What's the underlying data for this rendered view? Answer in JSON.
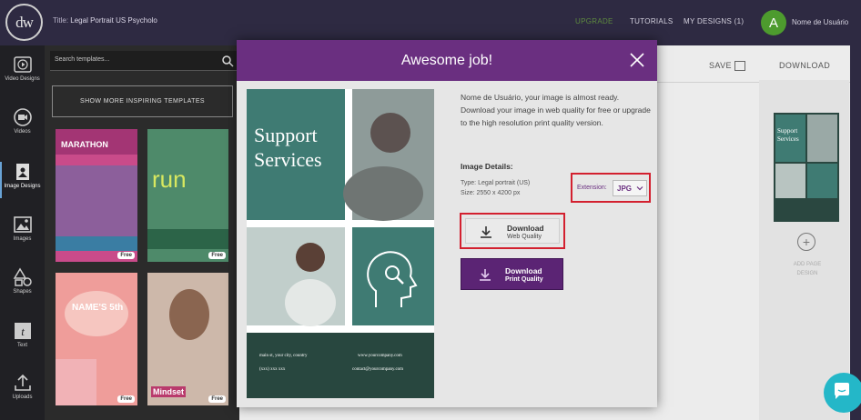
{
  "header": {
    "logo": "dw",
    "title_prefix": "Title:",
    "title": "Legal Portrait US Psycholo",
    "nav": {
      "upgrade": "UPGRADE",
      "tutorials": "TUTORIALS",
      "my_designs": "MY DESIGNS (1)"
    },
    "avatar_letter": "A",
    "username": "Nome de Usuário"
  },
  "sidebar": {
    "items": [
      {
        "label": "Video Designs",
        "icon": "play-icon"
      },
      {
        "label": "Videos",
        "icon": "video-icon"
      },
      {
        "label": "Image Designs",
        "icon": "image-design-icon"
      },
      {
        "label": "Images",
        "icon": "image-icon"
      },
      {
        "label": "Shapes",
        "icon": "shapes-icon"
      },
      {
        "label": "Text",
        "icon": "text-icon"
      },
      {
        "label": "Uploads",
        "icon": "upload-icon"
      }
    ]
  },
  "templates": {
    "search_placeholder": "Search templates...",
    "show_more": "SHOW MORE INSPIRING TEMPLATES",
    "cards": [
      {
        "text": "MARATHON",
        "badge": "Free"
      },
      {
        "text": "run",
        "badge": "Free"
      },
      {
        "text": "NAME'S 5th",
        "badge": "Free"
      },
      {
        "text": "Mindset",
        "badge": "Free"
      }
    ]
  },
  "toolbar": {
    "save": "SAVE",
    "download": "DOWNLOAD"
  },
  "modal": {
    "title": "Awesome job!",
    "message": "Nome de Usuário, your image is almost ready. Download your image in web quality for free or upgrade to the high resolution print quality version.",
    "details_heading": "Image Details:",
    "type": "Type: Legal portrait (US)",
    "size": "Size: 2550 x 4200 px",
    "extension_label": "Extension:",
    "extension_value": "JPG",
    "web": {
      "title": "Download",
      "subtitle": "Web Quality"
    },
    "print": {
      "title": "Download",
      "subtitle": "Print Quality"
    },
    "preview": {
      "headline_1": "Support",
      "headline_2": "Services",
      "footer_left": "main st, your city, country",
      "footer_left_2": "(xxx) xxx xxx",
      "footer_right": "www.yourcompany.com",
      "footer_right_2": "contact@yourcompany.com"
    }
  },
  "right_panel": {
    "add_page_label": "ADD PAGE DESIGN",
    "thumb_headline_1": "Support",
    "thumb_headline_2": "Services"
  },
  "colors": {
    "header": "#2e2a42",
    "modal_header": "#6a2f80",
    "accent_red": "#d3202f",
    "teal": "#3f7b73",
    "dark_teal": "#28473f",
    "chat": "#24b7c8"
  }
}
